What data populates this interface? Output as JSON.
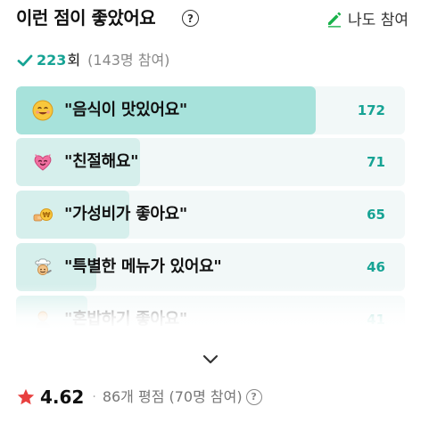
{
  "header": {
    "title": "이런 점이 좋았어요",
    "help_glyph": "?",
    "write_label": "나도 참여"
  },
  "summary": {
    "count": "223",
    "count_unit": "회",
    "participants": "(143명 참여)"
  },
  "colors": {
    "accent": "#16a394",
    "fill_active": "#a7e2db",
    "fill_normal": "#d6efec",
    "row_bg": "#f2f8f8",
    "star": "#e8403f",
    "pencil": "#19b24b"
  },
  "items": [
    {
      "label": "\"음식이 맛있어요\"",
      "count": "172",
      "share": 1.0,
      "emoji": "smile-face-icon"
    },
    {
      "label": "\"친절해요\"",
      "count": "71",
      "share": 0.413,
      "emoji": "heart-face-icon"
    },
    {
      "label": "\"가성비가 좋아요\"",
      "count": "65",
      "share": 0.378,
      "emoji": "money-hand-icon"
    },
    {
      "label": "\"특별한 메뉴가 있어요\"",
      "count": "46",
      "share": 0.267,
      "emoji": "chef-icon"
    },
    {
      "label": "\"혼밥하기 좋아요\"",
      "count": "41",
      "share": 0.238,
      "emoji": "solo-person-icon"
    }
  ],
  "rating": {
    "value": "4.62",
    "separator": "·",
    "detail": "86개 평점 (70명 참여)",
    "help_glyph": "?"
  }
}
